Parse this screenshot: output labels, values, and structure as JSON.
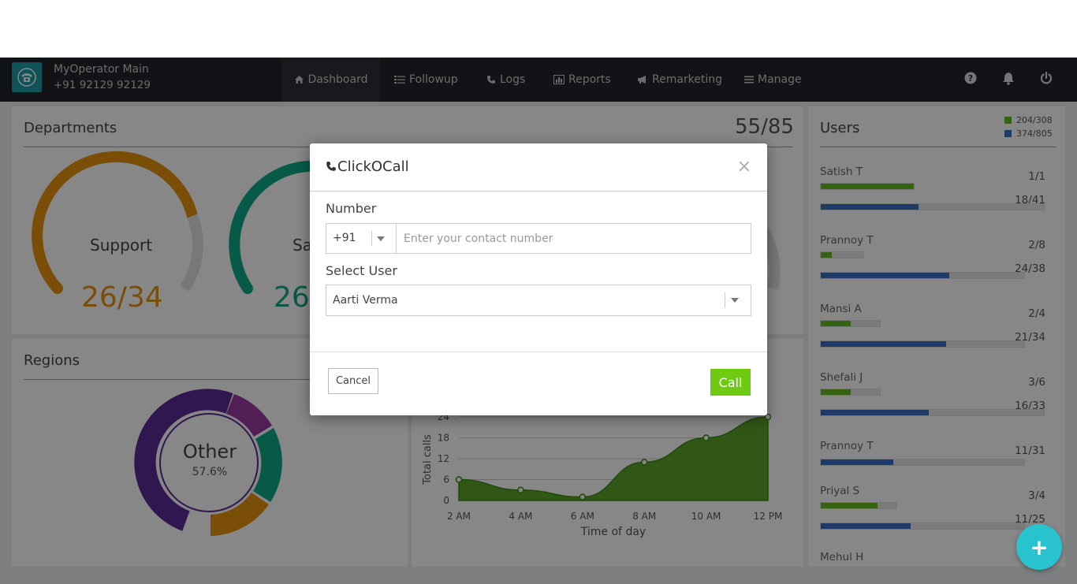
{
  "header": {
    "brand_name": "MyOperator Main",
    "brand_phone": "+91 92129 92129"
  },
  "nav": {
    "items": [
      {
        "label": "Dashboard",
        "icon": "home-icon"
      },
      {
        "label": "Followup",
        "icon": "list-icon"
      },
      {
        "label": "Logs",
        "icon": "phone-icon"
      },
      {
        "label": "Reports",
        "icon": "bar-chart-icon"
      },
      {
        "label": "Remarketing",
        "icon": "megaphone-icon"
      },
      {
        "label": "Manage",
        "icon": "menu-icon"
      }
    ],
    "active": "Dashboard",
    "right_icons": [
      "help-icon",
      "bell-icon",
      "power-icon"
    ]
  },
  "departments": {
    "title": "Departments",
    "total": "55/85",
    "gauges": [
      {
        "label": "Support",
        "value": "26/34",
        "color": "#e8940e",
        "fraction": 0.765
      },
      {
        "label": "Sa",
        "value": "26/",
        "color": "#0fa889",
        "fraction": 0.6
      }
    ]
  },
  "regions": {
    "title": "Regions",
    "center_label": "Other",
    "center_value": "57.6%",
    "colors": {
      "other": "#5b2c95",
      "pink": "#9a3ba0",
      "teal": "#0fa889",
      "orange": "#e8940e"
    }
  },
  "users": {
    "title": "Users",
    "legend": [
      {
        "value": "204/308",
        "color": "#66bb22"
      },
      {
        "value": "374/805",
        "color": "#3a6fc4"
      }
    ],
    "list": [
      {
        "name": "Satish T",
        "green": "1/1",
        "blue": "18/41",
        "green_frac": 1.0,
        "blue_frac": 0.439
      },
      {
        "name": "Prannoy T",
        "green": "2/8",
        "blue": "24/38",
        "green_frac": 0.25,
        "blue_frac": 0.632
      },
      {
        "name": "Mansi A",
        "green": "2/4",
        "blue": "21/34",
        "green_frac": 0.5,
        "blue_frac": 0.618
      },
      {
        "name": "Shefali J",
        "green": "3/6",
        "blue": "16/33",
        "green_frac": 0.5,
        "blue_frac": 0.485
      },
      {
        "name": "Prannoy T",
        "green": "",
        "blue": "11/31",
        "green_frac": 0,
        "blue_frac": 0.355
      },
      {
        "name": "Priyal S",
        "green": "3/4",
        "blue": "11/25",
        "green_frac": 0.75,
        "blue_frac": 0.44
      }
    ],
    "partial_name": "Mehul H"
  },
  "chart_data": {
    "type": "area",
    "xlabel": "Time of day",
    "ylabel": "Total calls",
    "x": [
      "2 AM",
      "4 AM",
      "6 AM",
      "8 AM",
      "10 AM",
      "12 PM"
    ],
    "y_ticks": [
      0,
      6,
      12,
      18,
      24
    ],
    "ylim": [
      0,
      24
    ],
    "series": [
      {
        "points": [
          [
            0,
            6
          ],
          [
            1,
            3
          ],
          [
            2,
            1
          ],
          [
            3,
            11
          ],
          [
            4,
            18
          ],
          [
            5,
            24
          ]
        ]
      }
    ],
    "color": "#5ea52c"
  },
  "modal": {
    "title": "ClickOCall",
    "number_label": "Number",
    "country_code": "+91",
    "number_placeholder": "Enter your contact number",
    "number_value": "",
    "select_user_label": "Select User",
    "selected_user": "Aarti Verma",
    "cancel_label": "Cancel",
    "call_label": "Call",
    "close_label": "×"
  },
  "fab": {
    "label": "+"
  }
}
